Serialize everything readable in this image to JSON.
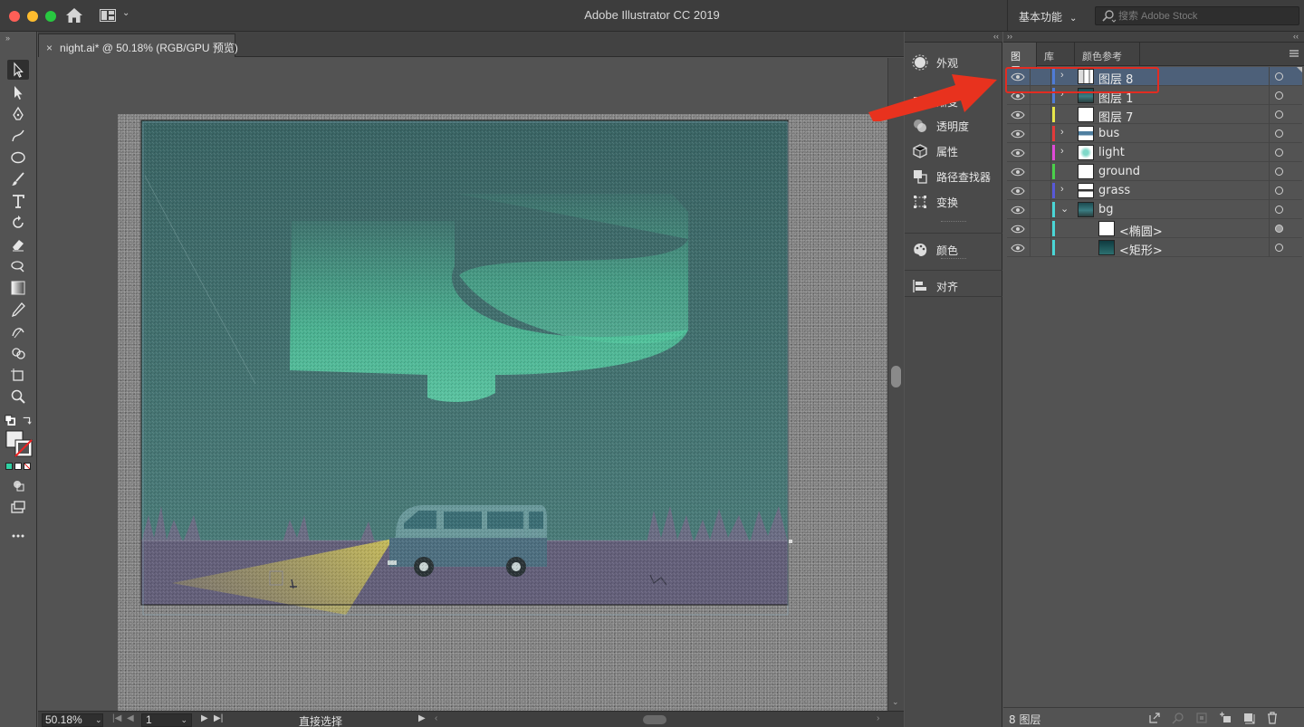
{
  "window": {
    "title": "Adobe Illustrator CC 2019",
    "workspace_label": "基本功能",
    "search_placeholder": "搜索 Adobe Stock"
  },
  "document": {
    "tab_label": "night.ai* @ 50.18% (RGB/GPU 预览)",
    "close_glyph": "×"
  },
  "statusbar": {
    "zoom": "50.18%",
    "page": "1",
    "tool_name": "直接选择"
  },
  "dock": {
    "items": [
      {
        "label": "外观",
        "icon": "appearance-icon"
      },
      {
        "label": "渐变",
        "icon": "gradient-icon"
      },
      {
        "label": "透明度",
        "icon": "transparency-icon"
      },
      {
        "label": "属性",
        "icon": "properties-icon"
      },
      {
        "label": "路径查找器",
        "icon": "pathfinder-icon"
      },
      {
        "label": "变换",
        "icon": "transform-icon"
      },
      {
        "label": "颜色",
        "icon": "color-icon"
      },
      {
        "label": "对齐",
        "icon": "align-icon"
      }
    ]
  },
  "layers_panel": {
    "tabs": [
      "图层",
      "库",
      "颜色参考"
    ],
    "active_tab": "图层",
    "layers": [
      {
        "name": "图层 8",
        "color": "#4f7bd6",
        "expandable": true,
        "selected": true,
        "thumb": "layer8"
      },
      {
        "name": "图层 1",
        "color": "#4f7bd6",
        "expandable": true,
        "selected": false,
        "thumb": "scene"
      },
      {
        "name": "图层 7",
        "color": "#e6e64a",
        "expandable": false,
        "selected": false,
        "thumb": "blank"
      },
      {
        "name": "bus",
        "color": "#e23a3a",
        "expandable": true,
        "selected": false,
        "thumb": "bus"
      },
      {
        "name": "light",
        "color": "#e04ad8",
        "expandable": true,
        "selected": false,
        "thumb": "light"
      },
      {
        "name": "ground",
        "color": "#4ad04a",
        "expandable": false,
        "selected": false,
        "thumb": "blank"
      },
      {
        "name": "grass",
        "color": "#5858d8",
        "expandable": true,
        "selected": false,
        "thumb": "grass"
      },
      {
        "name": "bg",
        "color": "#4ad6d6",
        "expandable": true,
        "expanded": true,
        "selected": false,
        "thumb": "scene"
      },
      {
        "name": "<椭圆>",
        "color": "#4ad6d6",
        "child": true,
        "selected": false,
        "thumb": "blank",
        "target_filled": true
      },
      {
        "name": "<矩形>",
        "color": "#4ad6d6",
        "child": true,
        "selected": false,
        "thumb": "dark"
      }
    ],
    "footer_count": "8 图层"
  },
  "colors": {
    "selection_row": "#4d6079",
    "annotation_red": "#e22c22",
    "sky": "#3f6a6a",
    "aurora": "#4ec79c",
    "ground": "#64607a",
    "headlight": "#b9ad55"
  }
}
